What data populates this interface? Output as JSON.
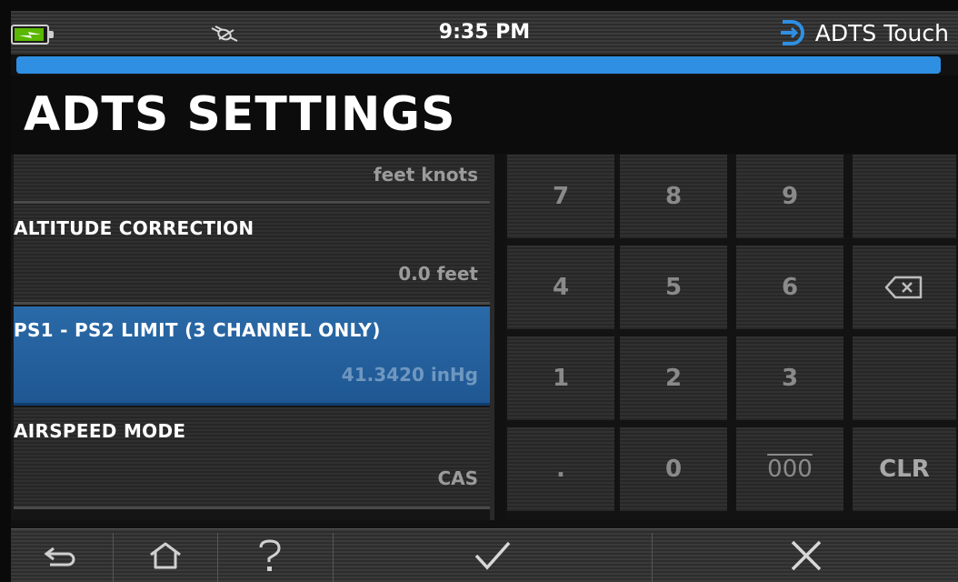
{
  "status_bar": {
    "time": "9:35 PM",
    "app_name": "ADTS Touch",
    "battery_icon": "battery-charging-icon",
    "connection_icon": "plug-disconnected-icon"
  },
  "progress": {
    "fraction": 1.0,
    "color": "#2f8fe3"
  },
  "page_title": "ADTS SETTINGS",
  "settings": [
    {
      "label": "",
      "value": "feet knots",
      "selected": false
    },
    {
      "label": "ALTITUDE CORRECTION",
      "value": "0.0 feet",
      "selected": false
    },
    {
      "label": "PS1 - PS2 LIMIT (3 CHANNEL ONLY)",
      "value": "41.3420 inHg",
      "selected": true
    },
    {
      "label": "AIRSPEED MODE",
      "value": "CAS",
      "selected": false
    }
  ],
  "keypad": {
    "rows": [
      [
        "7",
        "8",
        "9",
        ""
      ],
      [
        "4",
        "5",
        "6",
        "backspace"
      ],
      [
        "1",
        "2",
        "3",
        ""
      ],
      [
        ".",
        "0",
        "000",
        "CLR"
      ]
    ]
  },
  "bottom_nav": {
    "back_icon": "back-arrow-icon",
    "home_icon": "home-icon",
    "help_icon": "help-icon",
    "accept_icon": "checkmark-icon",
    "cancel_icon": "close-icon"
  },
  "colors": {
    "accent_blue": "#2f8fe3",
    "selected_row": "#2266a3",
    "battery_green": "#5ab800"
  }
}
